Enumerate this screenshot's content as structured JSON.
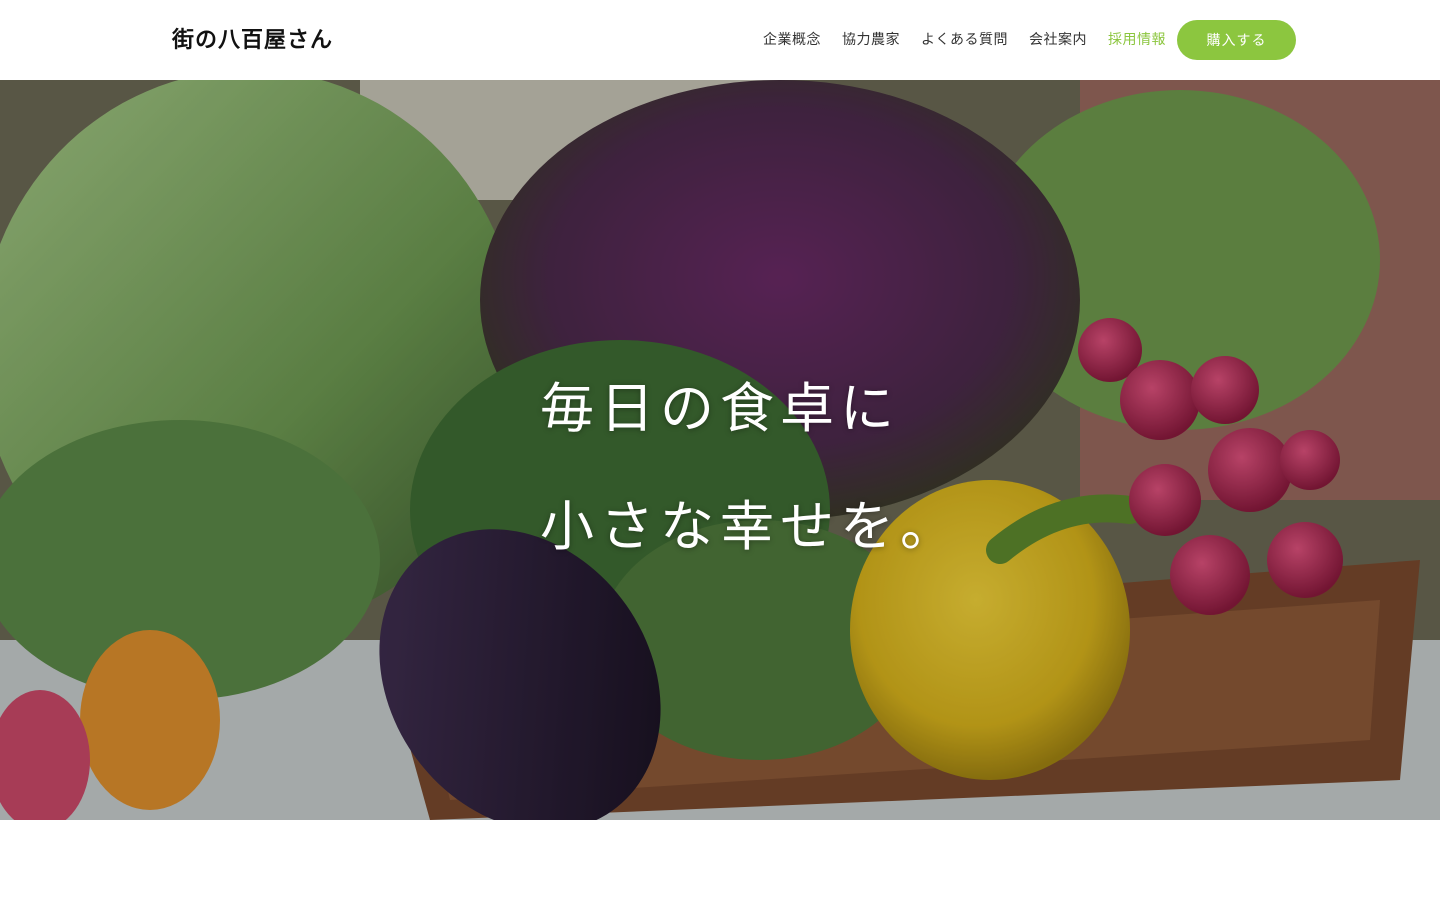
{
  "brand": {
    "logo_text": "街の八百屋さん"
  },
  "nav": {
    "items": [
      {
        "label": "企業概念",
        "active": false
      },
      {
        "label": "協力農家",
        "active": false
      },
      {
        "label": "よくある質問",
        "active": false
      },
      {
        "label": "会社案内",
        "active": false
      },
      {
        "label": "採用情報",
        "active": true
      }
    ],
    "cta_label": "購入する"
  },
  "hero": {
    "line1": "毎日の食卓に",
    "line2": "小さな幸せを。"
  },
  "colors": {
    "accent": "#8cc63f",
    "header_bg": "#ffffff",
    "nav_text": "#333333",
    "hero_text": "#ffffff"
  }
}
